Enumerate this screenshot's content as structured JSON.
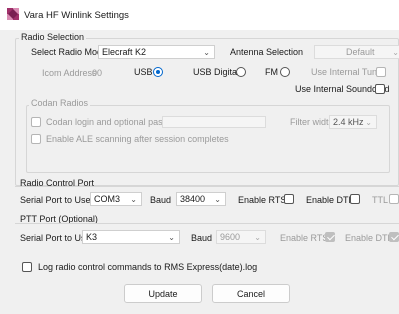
{
  "window": {
    "title": "Vara HF Winlink Settings"
  },
  "radio_selection": {
    "group_label": "Radio Selection",
    "select_model_label": "Select Radio Model",
    "model_value": "Elecraft K2",
    "antenna_label": "Antenna Selection",
    "antenna_value": "Default",
    "icom_address_label": "Icom Address",
    "icom_address_value": "00",
    "usb_label": "USB",
    "usb_digital_label": "USB Digital",
    "fm_label": "FM",
    "internal_tuner_label": "Use Internal Tuner",
    "internal_soundcard_label": "Use Internal Soundcard",
    "selected_mode": "USB"
  },
  "codan": {
    "group_label": "Codan Radios",
    "login_label": "Codan login and optional password:",
    "filter_label": "Filter width:",
    "filter_value": "2.4 kHz",
    "ale_label": "Enable ALE scanning after session completes"
  },
  "radio_control": {
    "section_label": "Radio Control Port",
    "serial_label": "Serial Port to Use",
    "serial_value": "COM3",
    "baud_label": "Baud",
    "baud_value": "38400",
    "rts_label": "Enable RTS",
    "dtr_label": "Enable DTR",
    "ttl_label": "TTL"
  },
  "ptt_port": {
    "section_label": "PTT Port (Optional)",
    "serial_label": "Serial Port to Use",
    "serial_value": "K3",
    "baud_label": "Baud",
    "baud_value": "9600",
    "rts_label": "Enable RTS",
    "dtr_label": "Enable DTR"
  },
  "log_option": {
    "label": "Log radio control commands to RMS Express(date).log"
  },
  "buttons": {
    "update": "Update",
    "cancel": "Cancel"
  },
  "colors": {
    "accent": "#0066cc",
    "background": "#f0f0f0",
    "disabled_text": "#9a9a9a"
  }
}
